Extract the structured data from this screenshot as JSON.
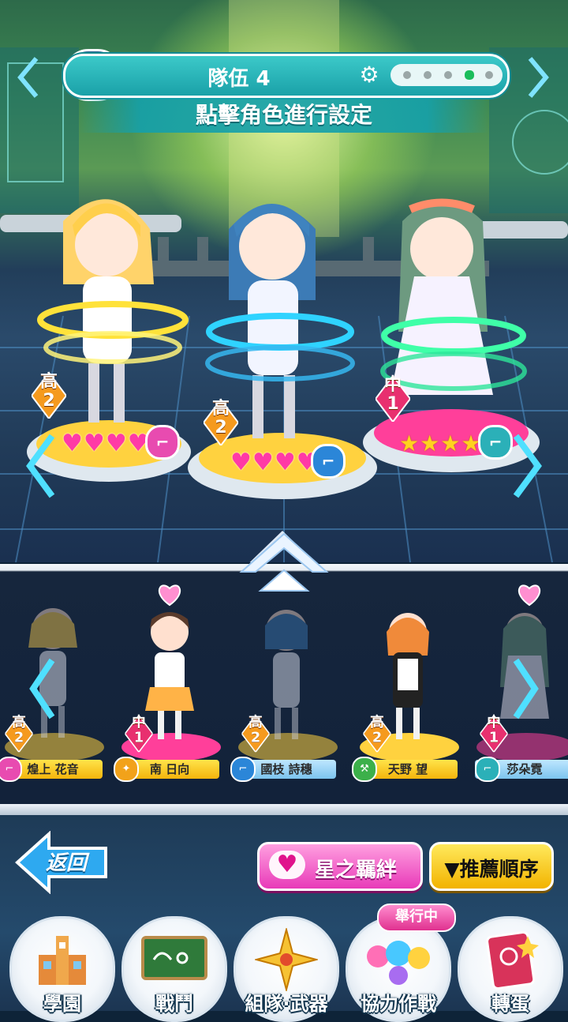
{
  "header": {
    "team_title": "隊伍 4",
    "subtitle": "點擊角色進行設定",
    "page_dots_total": 5,
    "page_dots_active": 4
  },
  "party": [
    {
      "name": "煌上 花音",
      "rank_label": "高",
      "rank_level": "2",
      "rating_type": "hearts",
      "rating": 4,
      "weapon": "sniper",
      "ring_color": "#ffe23a",
      "pedestal_color": "#ffd23f"
    },
    {
      "name": "國枝 詩穗",
      "rank_label": "高",
      "rank_level": "2",
      "rating_type": "hearts",
      "rating": 4,
      "weapon": "handgun",
      "ring_color": "#2fd3ff",
      "pedestal_color": "#ffd23f"
    },
    {
      "name": "莎朵霓",
      "rank_label": "中",
      "rank_level": "1",
      "rating_type": "stars",
      "rating": 4,
      "weapon": "handgun",
      "ring_color": "#3fffa8",
      "pedestal_color": "#ff3f9a"
    }
  ],
  "roster": [
    {
      "name": "煌上 花音",
      "rank_label": "高",
      "rank_level": "2",
      "icon": "sniper-icon",
      "icon_color": "#e84bb0",
      "pedestal": "#ffd23f",
      "in_party": true,
      "favorite": false
    },
    {
      "name": "南 日向",
      "rank_label": "中",
      "rank_level": "1",
      "icon": "wand-icon",
      "icon_color": "#f2a21a",
      "pedestal": "#ff3f9a",
      "in_party": false,
      "favorite": true
    },
    {
      "name": "國枝 詩穗",
      "rank_label": "高",
      "rank_level": "2",
      "icon": "handgun-icon",
      "icon_color": "#2b86d8",
      "pedestal": "#ffd23f",
      "in_party": true,
      "favorite": false
    },
    {
      "name": "天野 望",
      "rank_label": "高",
      "rank_level": "2",
      "icon": "hammer-icon",
      "icon_color": "#3cb04a",
      "pedestal": "#ffd23f",
      "in_party": false,
      "favorite": false
    },
    {
      "name": "莎朵霓",
      "rank_label": "中",
      "rank_level": "1",
      "icon": "handgun-icon",
      "icon_color": "#2bb0b8",
      "pedestal": "#ff3f9a",
      "in_party": true,
      "favorite": true
    }
  ],
  "buttons": {
    "back": "返回",
    "bond": "星之羈絆",
    "sort": "▼推薦順序"
  },
  "bottom_nav": [
    {
      "label": "學園",
      "icon": "school-building-icon"
    },
    {
      "label": "戰鬥",
      "icon": "chalkboard-icon"
    },
    {
      "label": "組隊·武器",
      "icon": "compass-star-icon"
    },
    {
      "label": "協力作戰",
      "icon": "co-op-balloons-icon",
      "badge": "舉行中"
    },
    {
      "label": "轉蛋",
      "icon": "gacha-card-icon"
    }
  ],
  "colors": {
    "accent_teal": "#1aa1a8",
    "heart_pink": "#ff3aa6",
    "sort_yellow": "#f2b300",
    "bond_pink": "#e83ab8"
  }
}
